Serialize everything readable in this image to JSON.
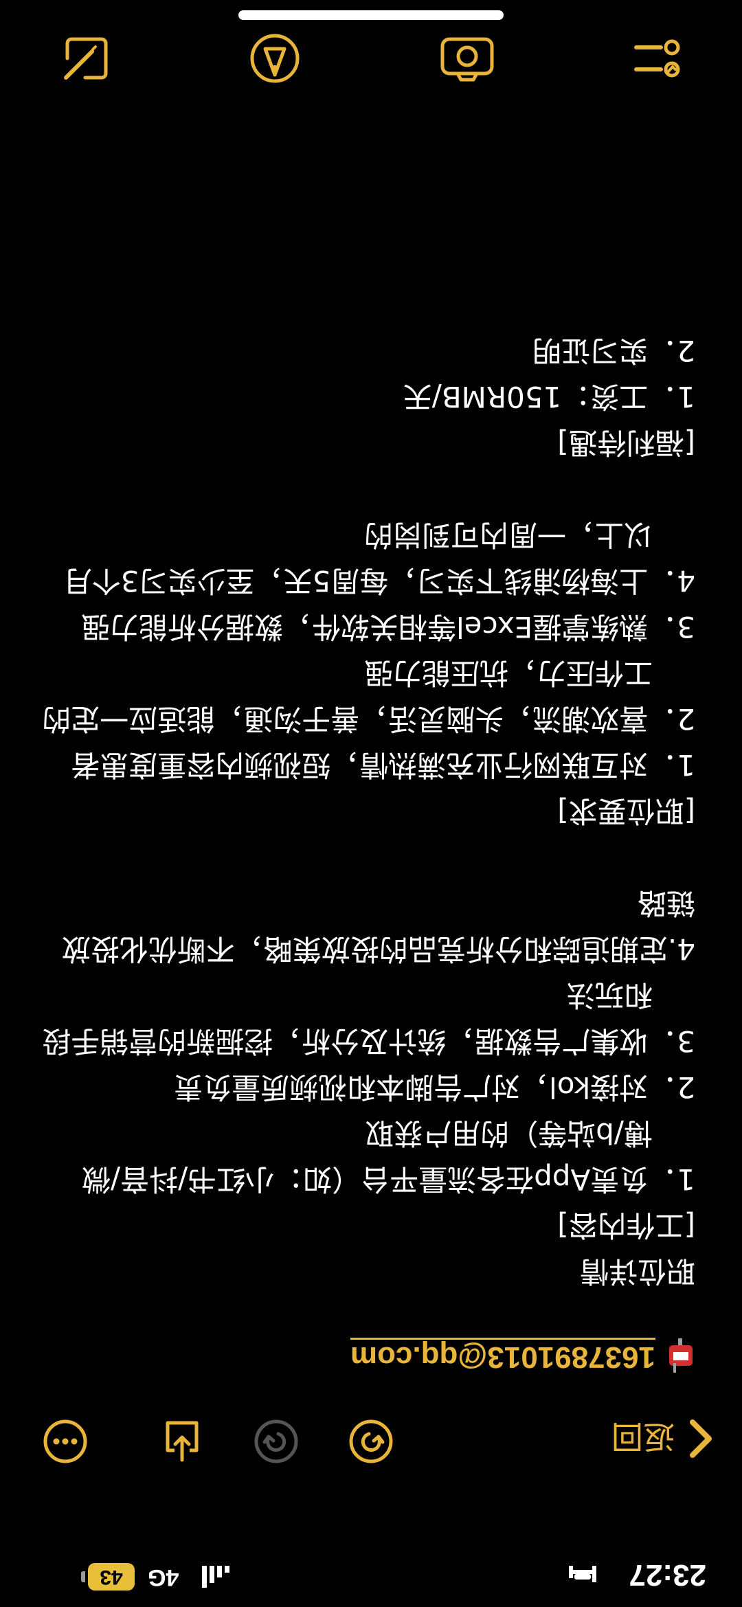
{
  "status_bar": {
    "time": "23:27",
    "network": "4G",
    "battery": "43"
  },
  "toolbar": {
    "back_label": "返回",
    "icons": [
      "chevron-left-icon",
      "redo-icon",
      "undo-icon",
      "share-icon",
      "more-icon"
    ]
  },
  "note": {
    "email": "1637891013@qq.com",
    "title": "职位详情",
    "work_header": "[工作内容]",
    "work_1": "1．负责App在各流量平台（如：小红书/抖音/微博/b站等）的用户获取",
    "work_2": "2．对接kol，对广告脚本和视频质量负责",
    "work_3": "3．收集广告数据，统计及分析，挖掘新的营销手段和玩法",
    "work_4": "4.定期追踪和分析竞品的投放策略，不断优化投放链路",
    "req_header": "[职位要求]",
    "req_1": "1．对互联网行业充满热情，短视频内容重度患者",
    "req_2": "2．喜欢潮流，头脑灵活，善于沟通，能适应一定的工作压力，抗压能力强",
    "req_3": "3．熟练掌握Excel等相关软件，数据分析能力强",
    "req_4": "4．上海杨浦线下实习，每周5天，至少实习3个月以上，一周内可到岗的",
    "benefit_header": "[福利待遇]",
    "benefit_1": "1．工资：150RMB/天",
    "benefit_2": "2．实习证明"
  },
  "bottom_toolbar": {
    "icons": [
      "checklist-icon",
      "camera-icon",
      "markup-pen-icon",
      "compose-icon"
    ]
  },
  "colors": {
    "accent": "#e8b43a",
    "background": "#000000",
    "text": "#ffffff"
  }
}
